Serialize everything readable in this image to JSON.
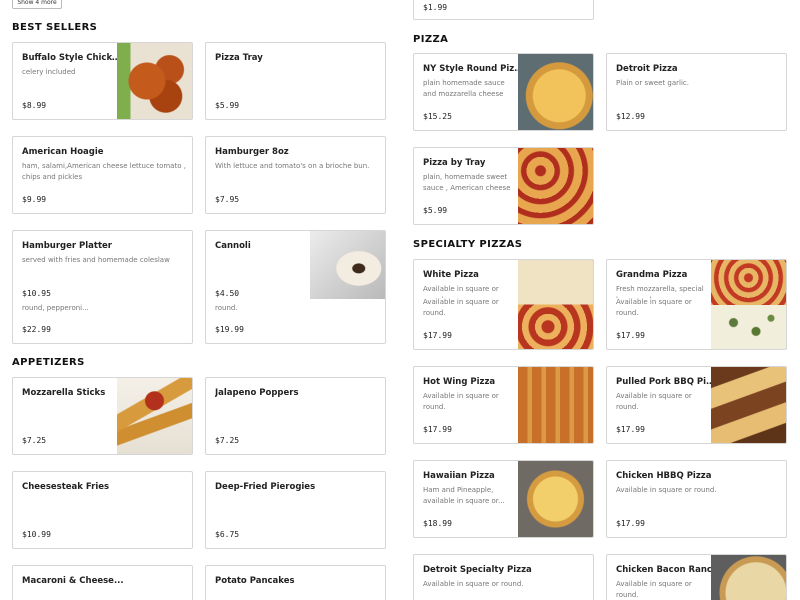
{
  "show_more_label": "Show 4 more",
  "top_partial_price": "$1.99",
  "sections": {
    "best_sellers": "BEST SELLERS",
    "appetizers": "APPETIZERS",
    "pizza": "PIZZA",
    "specialty": "SPECIALTY PIZZAS"
  },
  "best_sellers": [
    {
      "name": "Buffalo Style Chicke...",
      "desc": "celery included",
      "price": "$8.99",
      "image": "buffalo-wings"
    },
    {
      "name": "Pizza Tray",
      "desc": "",
      "price": "$5.99"
    },
    {
      "name": "American Hoagie",
      "desc": "ham, salami,American cheese lettuce tomato , chips and pickles",
      "price": "$9.99"
    },
    {
      "name": "Hamburger 8oz",
      "desc": "With lettuce and tomato's on a brioche bun.",
      "price": "$7.95"
    },
    {
      "name": "Hamburger Platter",
      "desc": "served with fries and homemade coleslaw",
      "price": "$10.95",
      "overlap_text": "round, pepperoni...",
      "overlap_price": "$22.99"
    },
    {
      "name": "Cannoli",
      "desc": "",
      "price": "$4.50",
      "image": "cannoli",
      "overlap_text": "round.",
      "overlap_price": "$19.99"
    }
  ],
  "appetizers": [
    {
      "name": "Mozzarella Sticks",
      "desc": "",
      "price": "$7.25",
      "image": "mozzarella-sticks"
    },
    {
      "name": "Jalapeno Poppers",
      "desc": "",
      "price": "$7.25"
    },
    {
      "name": "Cheesesteak Fries",
      "desc": "",
      "price": "$10.99"
    },
    {
      "name": "Deep-Fried Pierogies",
      "desc": "",
      "price": "$6.75"
    },
    {
      "name": "Macaroni & Cheese...",
      "desc": "",
      "price": ""
    },
    {
      "name": "Potato Pancakes",
      "desc": "",
      "price": ""
    }
  ],
  "pizza": [
    {
      "name": "NY Style Round Pizza",
      "desc": "plain homemade sauce and mozzarella cheese",
      "price": "$15.25",
      "image": "ny-round-pizza"
    },
    {
      "name": "Detroit Pizza",
      "desc": "Plain or sweet garlic.",
      "price": "$12.99"
    },
    {
      "name": "Pizza by Tray",
      "desc": "plain, homemade sweet sauce , American cheese",
      "price": "$5.99",
      "image": "pizza-tray"
    }
  ],
  "specialty": [
    {
      "name": "White Pizza",
      "desc": "Available in square or round.",
      "overlap": "Available in square or round.",
      "price": "$17.99",
      "image": "white-pizza"
    },
    {
      "name": "Grandma Pizza",
      "desc": "Fresh mozzarella, special homemade sauce, fresh...",
      "overlap": "Available in square or round.",
      "price": "$17.99",
      "image": "grandma-pizza"
    },
    {
      "name": "Hot Wing Pizza",
      "desc": "Available in square or round.",
      "price": "$17.99",
      "image": "hot-wing-pizza"
    },
    {
      "name": "Pulled Pork BBQ Pizza",
      "desc": "Available in square or round.",
      "price": "$17.99",
      "image": "bbq-pizza"
    },
    {
      "name": "Hawaiian Pizza",
      "desc": "Ham and Pineapple, available in square or...",
      "price": "$18.99",
      "image": "hawaiian-pizza"
    },
    {
      "name": "Chicken HBBQ Pizza",
      "desc": "Available in square or round.",
      "price": "$17.99"
    },
    {
      "name": "Detroit Specialty Pizza",
      "desc": "Available in square or round.",
      "price": ""
    },
    {
      "name": "Chicken Bacon Ranch",
      "desc": "Available in square or round.",
      "price": "",
      "image": "chicken-bacon-ranch-pizza"
    }
  ]
}
